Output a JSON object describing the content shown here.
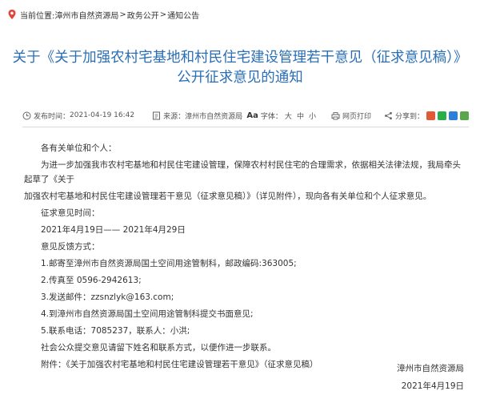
{
  "breadcrumb": {
    "prefix": "当前位置:",
    "items": [
      "漳州市自然资源局",
      "政务公开",
      "通知公告"
    ],
    "sep": ">"
  },
  "title": {
    "line1": "关于《关于加强农村宅基地和村民住宅建设管理若干意见（征求意见稿）》",
    "line2": "公开征求意见的通知"
  },
  "meta": {
    "date_label": "发布时间：",
    "date": "2021-04-19 16:42",
    "source_label": "来源：",
    "source": "漳州市自然资源局",
    "font_label": "字体：",
    "sizes": [
      "大",
      "中",
      "小"
    ],
    "print_label": "网页打印",
    "share_label": "分享到："
  },
  "body": {
    "salutation": "各有关单位和个人：",
    "para1a": "为进一步加强我市农村宅基地和村民住宅建设管理，保障农村村民住宅的合理需求，依据相关法律法规，我局牵头起草了《关于",
    "para1b": "加强农村宅基地和村民住宅建设管理若干意见（征求意见稿）》（详见附件），现向各有关单位和个人征求意见。",
    "period_label": "征求意见时间：",
    "period": "2021年4月19日—— 2021年4月29日",
    "methods_label": "意见反馈方式：",
    "m1": "1.邮寄至漳州市自然资源局国土空间用途管制科，邮政编码:363005;",
    "m2": "2.传真至 0596-2942613;",
    "m3": "3.发送邮件：zzsnzlyk@163.com;",
    "m4": "4.到漳州市自然资源局国土空间用途管制科提交书面意见;",
    "m5": "5.联系电话：7085237，联系人：小洪;",
    "note": "社会公众提交意见请留下姓名和联系方式，以便作进一步联系。",
    "attach_label": "附件：",
    "attach_link": "《关于加强农村宅基地和村民住宅建设管理若干意见》（征求意见稿）"
  },
  "signature": {
    "org": "漳州市自然资源局",
    "date": "2021年4月19日"
  },
  "colors": {
    "title": "#2a6fb6",
    "text": "#333333",
    "divider": "#d9d9d9"
  }
}
